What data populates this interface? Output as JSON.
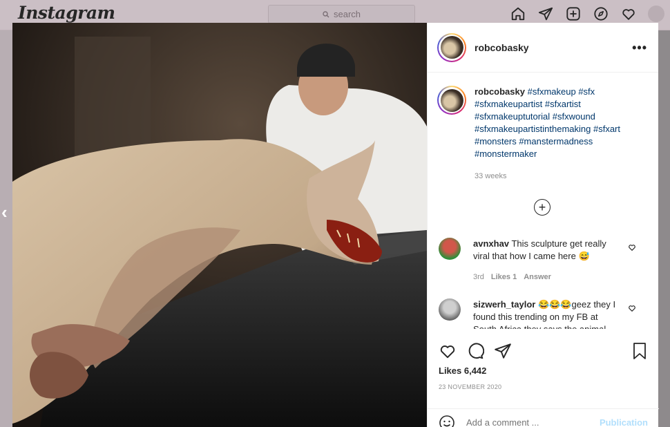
{
  "topbar": {
    "logo": "Instagram",
    "search_placeholder": "search",
    "icons": [
      "home-icon",
      "direct-icon",
      "new-post-icon",
      "explore-icon",
      "activity-icon",
      "profile-avatar"
    ]
  },
  "post": {
    "username": "robcobasky",
    "more_label": "•••",
    "caption_user": "robcobasky",
    "caption_tags": [
      "#sfxmakeup",
      "#sfx",
      "#sfxmakeupartist",
      "#sfxartist",
      "#sfxmakeuptutorial",
      "#sfxwound",
      "#sfxmakeupartistinthemaking",
      "#sfxart",
      "#monsters",
      "#manstermadness",
      "#monstermaker"
    ],
    "caption_time": "33 weeks",
    "load_more_icon": "plus-circle-icon",
    "comments": [
      {
        "user": "avnxhav",
        "text": "This sculpture get really viral that how I came here 😅",
        "time": "3rd",
        "likes": "Likes 1",
        "reply": "Answer"
      },
      {
        "user": "sizwerh_taylor",
        "text": "😂😂😂geez they I found this trending on my FB at South Africa they says the animal"
      }
    ],
    "likes": "Likes 6,442",
    "date": "23 NOVEMBER 2020",
    "add_comment_placeholder": "Add a comment ...",
    "post_button": "Publication"
  },
  "colors": {
    "link": "#00376b",
    "muted": "#8e8e8e",
    "post_button_disabled": "#b2dffc",
    "overlay": "#d6c9cf"
  }
}
